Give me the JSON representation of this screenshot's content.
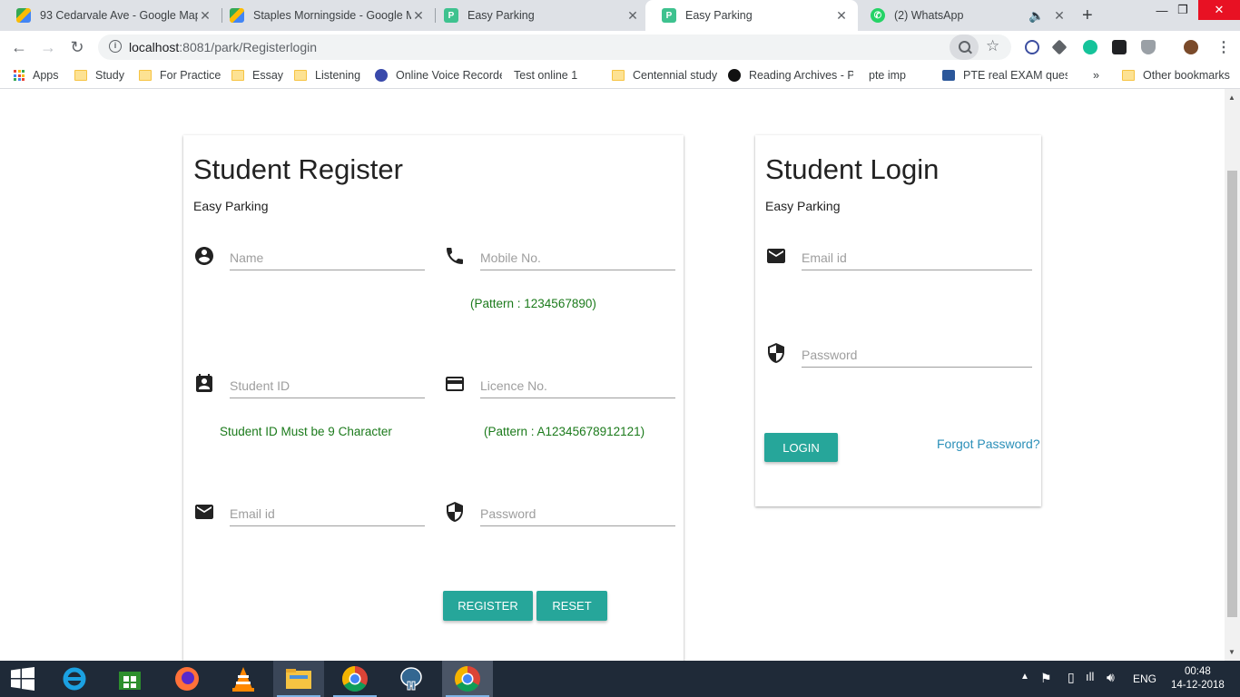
{
  "browser": {
    "tabs": [
      {
        "title": "93 Cedarvale Ave - Google Map",
        "favicon": "google-maps-icon",
        "active": false
      },
      {
        "title": "Staples Morningside - Google M",
        "favicon": "google-maps-icon",
        "active": false
      },
      {
        "title": "Easy Parking",
        "favicon": "easy-parking-icon",
        "active": false
      },
      {
        "title": "Easy Parking",
        "favicon": "easy-parking-icon",
        "active": true
      },
      {
        "title": "(2) WhatsApp",
        "favicon": "whatsapp-icon",
        "active": false
      }
    ],
    "url_host": "localhost",
    "url_rest": ":8081/park/Registerlogin",
    "bookmarks": [
      {
        "label": "Apps",
        "icon": "apps-icon"
      },
      {
        "label": "Study",
        "icon": "folder-icon"
      },
      {
        "label": "For Practice",
        "icon": "folder-icon"
      },
      {
        "label": "Essay",
        "icon": "folder-icon"
      },
      {
        "label": "Listening",
        "icon": "folder-icon"
      },
      {
        "label": "Online Voice Recorde",
        "icon": "recorder-icon"
      },
      {
        "label": "Test online 1",
        "icon": "page-icon"
      },
      {
        "label": "Centennial study",
        "icon": "folder-icon"
      },
      {
        "label": "Reading Archives - P",
        "icon": "g-icon"
      },
      {
        "label": "pte imp",
        "icon": "page-icon"
      },
      {
        "label": "PTE real EXAM questi",
        "icon": "word-icon"
      }
    ],
    "more_bookmarks": "»",
    "other_bookmarks": "Other bookmarks"
  },
  "register": {
    "title": "Student Register",
    "subtitle": "Easy Parking",
    "name_placeholder": "Name",
    "mobile_placeholder": "Mobile No.",
    "mobile_hint": "(Pattern : 1234567890)",
    "student_id_placeholder": "Student ID",
    "student_id_hint": "Student ID Must be 9 Character",
    "licence_placeholder": "Licence No.",
    "licence_hint": "(Pattern : A12345678912121)",
    "email_placeholder": "Email id",
    "password_placeholder": "Password",
    "register_label": "REGISTER",
    "reset_label": "RESET"
  },
  "login": {
    "title": "Student Login",
    "subtitle": "Easy Parking",
    "email_placeholder": "Email id",
    "password_placeholder": "Password",
    "login_label": "LOGIN",
    "forgot_label": "Forgot Password?"
  },
  "taskbar": {
    "language": "ENG",
    "time": "00:48",
    "date": "14-12-2018"
  },
  "colors": {
    "accent": "#26a69a",
    "hint_green": "#1b7a1b",
    "link_blue": "#2a8fb8"
  }
}
